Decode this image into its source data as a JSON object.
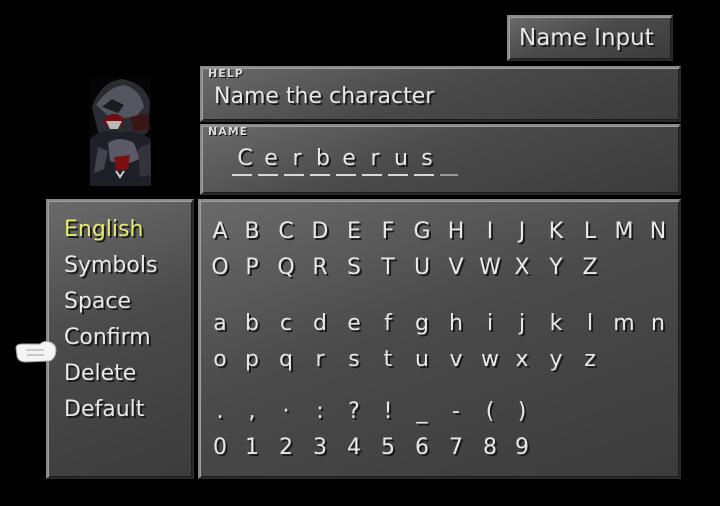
{
  "title": "Name Input",
  "help": {
    "tag": "HELP",
    "text": "Name the character"
  },
  "name": {
    "tag": "NAME",
    "chars": [
      "C",
      "e",
      "r",
      "b",
      "e",
      "r",
      "u",
      "s"
    ]
  },
  "menu": {
    "items": [
      "English",
      "Symbols",
      "Space",
      "Confirm",
      "Delete",
      "Default"
    ],
    "selected": "English",
    "cursor": "Confirm"
  },
  "keyboard": {
    "rows": [
      [
        "A",
        "B",
        "C",
        "D",
        "E",
        "F",
        "G",
        "H",
        "I",
        "J",
        "K",
        "L",
        "M",
        "N"
      ],
      [
        "O",
        "P",
        "Q",
        "R",
        "S",
        "T",
        "U",
        "V",
        "W",
        "X",
        "Y",
        "Z"
      ],
      [
        "a",
        "b",
        "c",
        "d",
        "e",
        "f",
        "g",
        "h",
        "i",
        "j",
        "k",
        "l",
        "m",
        "n"
      ],
      [
        "o",
        "p",
        "q",
        "r",
        "s",
        "t",
        "u",
        "v",
        "w",
        "x",
        "y",
        "z"
      ],
      [
        ".",
        ",",
        "·",
        ":",
        "?",
        "!",
        "_",
        "-",
        "(",
        ")"
      ],
      [
        "0",
        "1",
        "2",
        "3",
        "4",
        "5",
        "6",
        "7",
        "8",
        "9"
      ]
    ]
  },
  "icons": {
    "cursor": "pointing-hand-icon",
    "portrait": "cerberus-portrait"
  },
  "colors": {
    "selected_text": "#e8e86a",
    "window": "#4a4a4a"
  }
}
